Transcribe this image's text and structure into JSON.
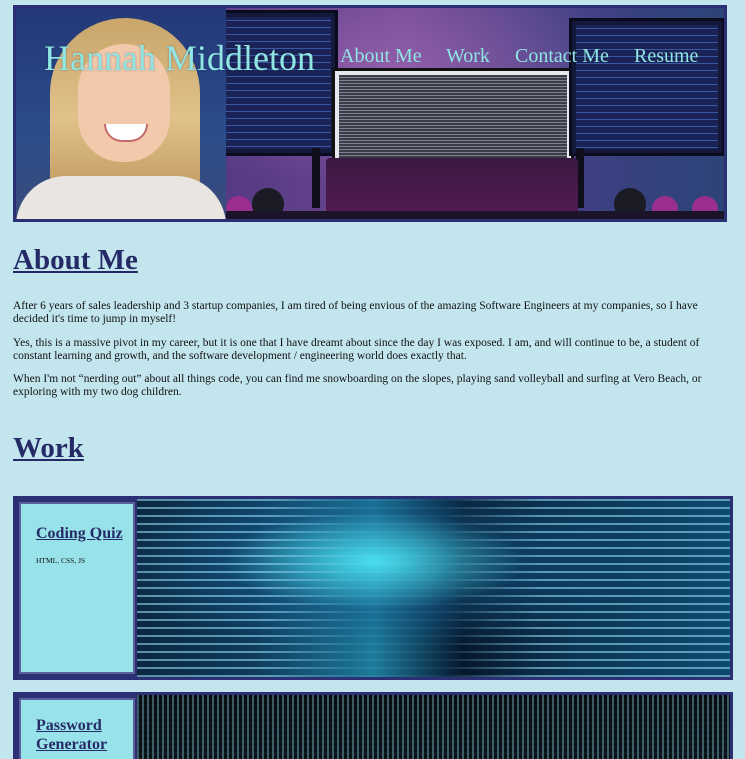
{
  "header": {
    "site_title": "Hannah Middleton",
    "nav": [
      {
        "label": "About Me"
      },
      {
        "label": "Work"
      },
      {
        "label": "Contact Me"
      },
      {
        "label": "Resume"
      }
    ]
  },
  "about": {
    "heading": "About Me",
    "paragraphs": [
      "After 6 years of sales leadership and 3 startup companies, I am tired of being envious of the amazing Software Engineers at my companies, so I have decided it's time to jump in myself!",
      "Yes, this is a massive pivot in my career, but it is one that I have dreamt about since the day I was exposed. I am, and will continue to be, a student of constant learning and growth, and the software development / engineering world does exactly that.",
      "When I'm not “nerding out” about all things code, you can find me snowboarding on the slopes, playing sand volleyball and surfing at Vero Beach, or exploring with my two dog children."
    ]
  },
  "work": {
    "heading": "Work",
    "projects": [
      {
        "title": "Coding Quiz",
        "stack": "HTML, CSS, JS"
      },
      {
        "title": "Password Generator"
      }
    ]
  },
  "colors": {
    "page_background": "#c3e6ee",
    "heading": "#252a66",
    "hero_text": "#8fe6e2",
    "card_border": "#2b2f74",
    "card_info_background": "#98e3ea"
  }
}
